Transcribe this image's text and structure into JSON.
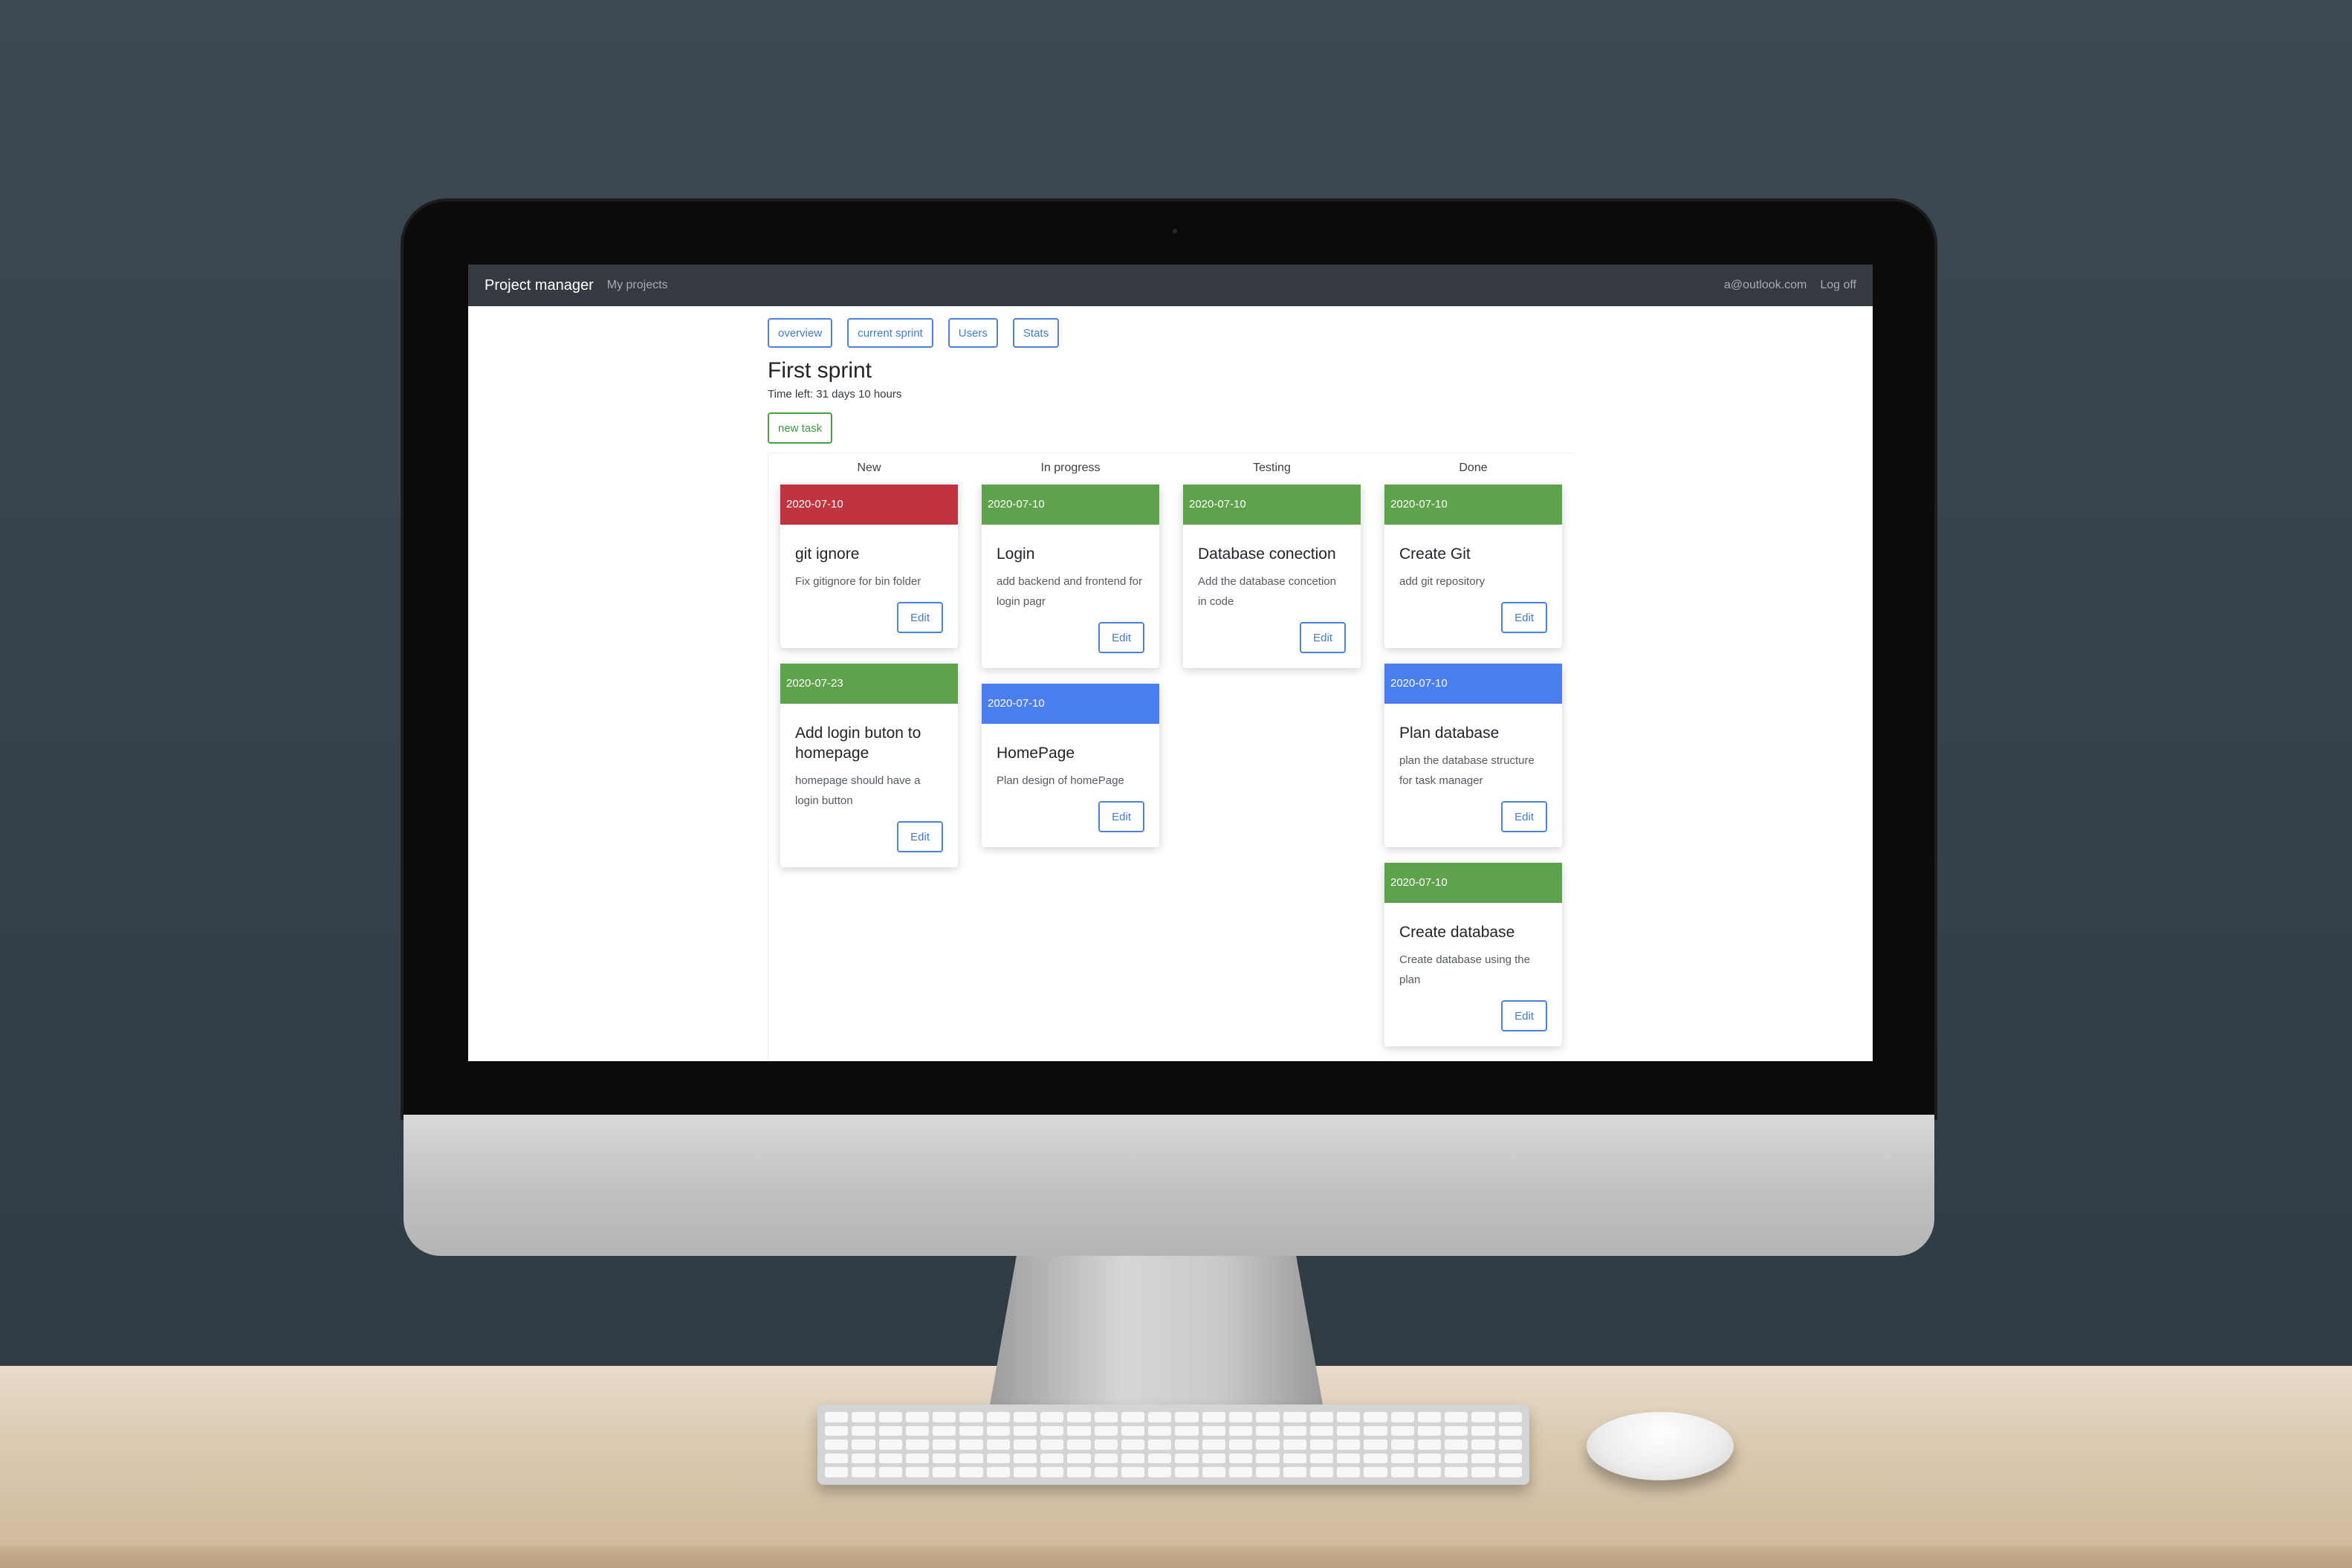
{
  "navbar": {
    "brand": "Project manager",
    "my_projects": "My projects",
    "email": "a@outlook.com",
    "logoff": "Log off"
  },
  "tabs": [
    "overview",
    "current sprint",
    "Users",
    "Stats"
  ],
  "sprint": {
    "title": "First sprint",
    "time_left": "Time left: 31 days 10 hours",
    "new_task_label": "new task"
  },
  "colors": {
    "red": "#c0343f",
    "green": "#5ea24c",
    "blue": "#4a7df0"
  },
  "columns": [
    {
      "name": "New",
      "cards": [
        {
          "date": "2020-07-10",
          "color": "#c0343f",
          "title": "git ignore",
          "desc": "Fix gitignore for bin folder",
          "edit": "Edit"
        },
        {
          "date": "2020-07-23",
          "color": "#5ea24c",
          "title": "Add login buton to homepage",
          "desc": "homepage should have a login button",
          "edit": "Edit"
        }
      ]
    },
    {
      "name": "In progress",
      "cards": [
        {
          "date": "2020-07-10",
          "color": "#5ea24c",
          "title": "Login",
          "desc": "add backend and frontend for login pagr",
          "edit": "Edit"
        },
        {
          "date": "2020-07-10",
          "color": "#4a7df0",
          "title": "HomePage",
          "desc": "Plan design of homePage",
          "edit": "Edit"
        }
      ]
    },
    {
      "name": "Testing",
      "cards": [
        {
          "date": "2020-07-10",
          "color": "#5ea24c",
          "title": "Database conection",
          "desc": "Add the database concetion in code",
          "edit": "Edit"
        }
      ]
    },
    {
      "name": "Done",
      "cards": [
        {
          "date": "2020-07-10",
          "color": "#5ea24c",
          "title": "Create Git",
          "desc": "add git repository",
          "edit": "Edit"
        },
        {
          "date": "2020-07-10",
          "color": "#4a7df0",
          "title": "Plan database",
          "desc": "plan the database structure for task manager",
          "edit": "Edit"
        },
        {
          "date": "2020-07-10",
          "color": "#5ea24c",
          "title": "Create database",
          "desc": "Create database using the plan",
          "edit": "Edit"
        }
      ]
    }
  ]
}
